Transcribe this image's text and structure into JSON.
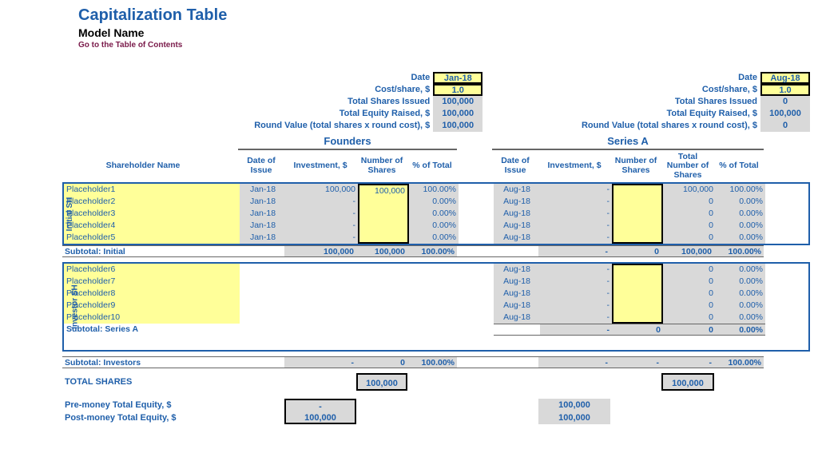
{
  "header": {
    "title": "Capitalization Table",
    "model_name": "Model Name",
    "toc_link": "Go to the Table of Contents"
  },
  "summary_labels": {
    "date": "Date",
    "cost": "Cost/share, $",
    "shares": "Total Shares Issued",
    "equity": "Total Equity Raised, $",
    "round_value": "Round Value (total shares x round cost), $"
  },
  "rounds": {
    "founders": {
      "label": "Founders",
      "date": "Jan-18",
      "cost": "1.0",
      "shares": "100,000",
      "equity": "100,000",
      "round_value": "100,000"
    },
    "seriesA": {
      "label": "Series A",
      "date": "Aug-18",
      "cost": "1.0",
      "shares": "0",
      "equity": "100,000",
      "round_value": "0"
    }
  },
  "columns": {
    "shareholder": "Shareholder Name",
    "date": "Date of Issue",
    "investment": "Investment, $",
    "number": "Number of Shares",
    "pct": "% of Total",
    "total_number": "Total Number of Shares"
  },
  "sections": {
    "initial": {
      "vlabel": "Initial SH",
      "rows": [
        {
          "name": "Placeholder1",
          "f_date": "Jan-18",
          "f_inv": "100,000",
          "f_num": "100,000",
          "f_pct": "100.00%",
          "a_date": "Aug-18",
          "a_inv": "-",
          "a_num": "",
          "a_tot": "100,000",
          "a_pct": "100.00%"
        },
        {
          "name": "Placeholder2",
          "f_date": "Jan-18",
          "f_inv": "-",
          "f_num": "",
          "f_pct": "0.00%",
          "a_date": "Aug-18",
          "a_inv": "-",
          "a_num": "",
          "a_tot": "0",
          "a_pct": "0.00%"
        },
        {
          "name": "Placeholder3",
          "f_date": "Jan-18",
          "f_inv": "-",
          "f_num": "",
          "f_pct": "0.00%",
          "a_date": "Aug-18",
          "a_inv": "-",
          "a_num": "",
          "a_tot": "0",
          "a_pct": "0.00%"
        },
        {
          "name": "Placeholder4",
          "f_date": "Jan-18",
          "f_inv": "-",
          "f_num": "",
          "f_pct": "0.00%",
          "a_date": "Aug-18",
          "a_inv": "-",
          "a_num": "",
          "a_tot": "0",
          "a_pct": "0.00%"
        },
        {
          "name": "Placeholder5",
          "f_date": "Jan-18",
          "f_inv": "-",
          "f_num": "",
          "f_pct": "0.00%",
          "a_date": "Aug-18",
          "a_inv": "-",
          "a_num": "",
          "a_tot": "0",
          "a_pct": "0.00%"
        }
      ],
      "subtotal": {
        "label": "Subtotal: Initial",
        "f_inv": "100,000",
        "f_num": "100,000",
        "f_pct": "100.00%",
        "a_inv": "-",
        "a_num": "0",
        "a_tot": "100,000",
        "a_pct": "100.00%"
      }
    },
    "investor": {
      "vlabel": "Investor SH",
      "rows": [
        {
          "name": "Placeholder6",
          "a_date": "Aug-18",
          "a_inv": "-",
          "a_num": "",
          "a_tot": "0",
          "a_pct": "0.00%"
        },
        {
          "name": "Placeholder7",
          "a_date": "Aug-18",
          "a_inv": "-",
          "a_num": "",
          "a_tot": "0",
          "a_pct": "0.00%"
        },
        {
          "name": "Placeholder8",
          "a_date": "Aug-18",
          "a_inv": "-",
          "a_num": "",
          "a_tot": "0",
          "a_pct": "0.00%"
        },
        {
          "name": "Placeholder9",
          "a_date": "Aug-18",
          "a_inv": "-",
          "a_num": "",
          "a_tot": "0",
          "a_pct": "0.00%"
        },
        {
          "name": "Placeholder10",
          "a_date": "Aug-18",
          "a_inv": "-",
          "a_num": "",
          "a_tot": "0",
          "a_pct": "0.00%"
        }
      ],
      "subtotal": {
        "label": "Subtotal: Series A",
        "a_inv": "-",
        "a_num": "0",
        "a_tot": "0",
        "a_pct": "0.00%"
      }
    }
  },
  "subtotal_investors": {
    "label": "Subtotal: Investors",
    "f_inv": "-",
    "f_num": "0",
    "f_pct": "100.00%",
    "a_inv": "-",
    "a_num": "-",
    "a_tot": "-",
    "a_pct": "100.00%"
  },
  "totals": {
    "total_shares_label": "TOTAL SHARES",
    "f_total_shares": "100,000",
    "a_total_shares": "100,000",
    "pre_label": "Pre-money Total Equity, $",
    "post_label": "Post-money Total Equity, $",
    "f_pre": "-",
    "f_post": "100,000",
    "a_pre": "100,000",
    "a_post": "100,000"
  }
}
